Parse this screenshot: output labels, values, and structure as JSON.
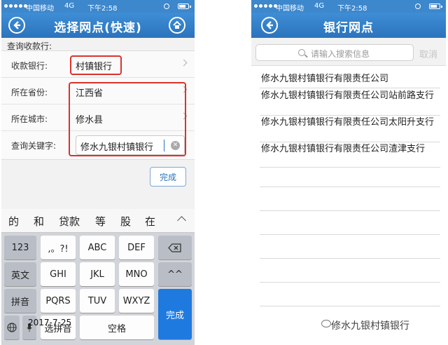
{
  "left_screen": {
    "status": {
      "carrier": "中国移动",
      "network": "4G",
      "time": "下午2:58"
    },
    "nav": {
      "title": "选择网点(快速)",
      "back_icon": "back-arrow-icon",
      "home_icon": "home-icon"
    },
    "section_label": "查询收款行:",
    "form": {
      "bank_label": "收款银行:",
      "bank_value": "村镇银行",
      "province_label": "所在省份:",
      "province_value": "江西省",
      "city_label": "所在城市:",
      "city_value": "修水县",
      "keyword_label": "查询关键字:",
      "keyword_value": "修水九银村镇银行"
    },
    "done_label": "完成",
    "keyboard": {
      "candidates": [
        "的",
        "和",
        "贷款",
        "等",
        "股",
        "在"
      ],
      "rows": [
        [
          "123",
          ",。?!",
          "ABC",
          "DEF",
          "⌫"
        ],
        [
          "英文",
          "GHI",
          "JKL",
          "MNO",
          "^^"
        ],
        [
          "拼音",
          "PQRS",
          "TUV",
          "WXYZ"
        ],
        [
          "选拼音",
          "空格"
        ]
      ],
      "done_label": "完成"
    },
    "date_stamp": "2017-7-25"
  },
  "right_screen": {
    "status": {
      "carrier": "中国移动",
      "network": "4G",
      "time": "下午2:58"
    },
    "nav": {
      "title": "银行网点",
      "back_icon": "back-arrow-icon"
    },
    "search": {
      "placeholder": "请输入搜索信息",
      "cancel_label": "取消"
    },
    "results": [
      "修水九银村镇银行有限责任公司",
      "修水九银村镇银行有限责任公司站前路支行",
      "修水九银村镇银行有限责任公司太阳升支行",
      "修水九银村镇银行有限责任公司渣津支行"
    ],
    "watermark": "修水九银村镇银行"
  },
  "colors": {
    "nav_blue": "#2b73bd",
    "highlight_red": "#d9332e",
    "key_blue": "#1f7ae0"
  }
}
